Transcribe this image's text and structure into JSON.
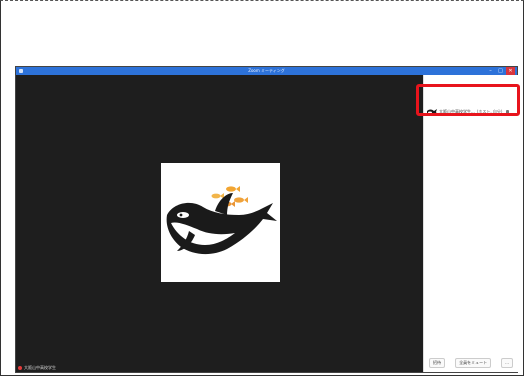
{
  "window": {
    "title": "Zoom ミーティング",
    "minimize_glyph": "–",
    "maximize_glyph": "□",
    "close_glyph": "✕"
  },
  "video": {
    "participant_name": "大阪山中高校学生"
  },
  "participants_panel": {
    "rows": [
      {
        "name": "大阪山中高校学生...",
        "role": "(ホスト, 自分)"
      }
    ],
    "footer": {
      "invite_label": "招待",
      "mute_all_label": "全員をミュート",
      "more_label": "..."
    }
  },
  "colors": {
    "titlebar": "#2d72d9",
    "video_bg": "#1e1e1e",
    "highlight": "#e8141c"
  },
  "icons": [
    "app-icon",
    "orca-avatar-icon",
    "fish-icon",
    "mic-muted-icon",
    "mic-icon"
  ]
}
